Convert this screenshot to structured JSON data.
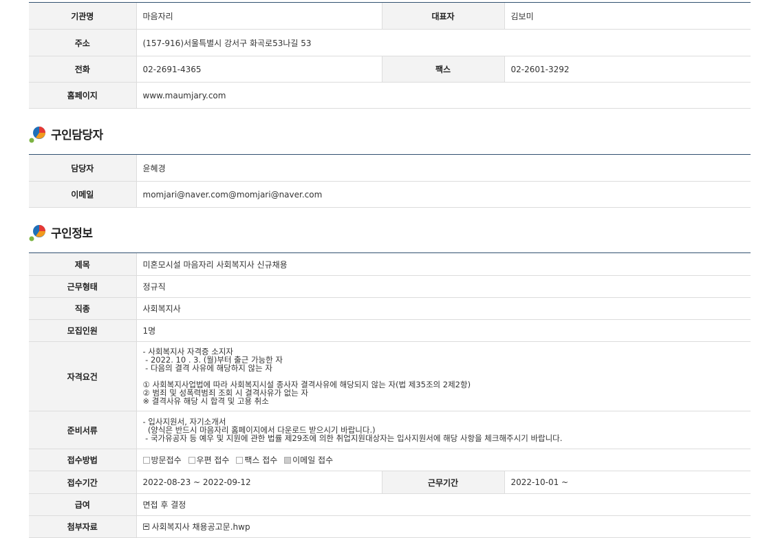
{
  "org": {
    "name_label": "기관명",
    "name": "마음자리",
    "ceo_label": "대표자",
    "ceo": "김보미",
    "address_label": "주소",
    "address": "(157-916)서울특별시 강서구 화곡로53나길 53",
    "phone_label": "전화",
    "phone": "02-2691-4365",
    "fax_label": "팩스",
    "fax": "02-2601-3292",
    "homepage_label": "홈페이지",
    "homepage": "www.maumjary.com"
  },
  "contact": {
    "title": "구인담당자",
    "manager_label": "담당자",
    "manager": "윤혜경",
    "email_label": "이메일",
    "email": "momjari@naver.com@momjari@naver.com"
  },
  "job": {
    "title": "구인정보",
    "subject_label": "제목",
    "subject": "미혼모시설 마음자리 사회복지사 신규채용",
    "worktype_label": "근무형태",
    "worktype": "정규직",
    "occupation_label": "직종",
    "occupation": "사회복지사",
    "headcount_label": "모집인원",
    "headcount": "1명",
    "requirements_label": "자격요건",
    "requirements": "- 사회복지사 자격증 소지자\n - 2022. 10 . 3. (월)부터 출근 가능한 자\n - 다음의 결격 사유에 해당하지 않는 자\n\n① 사회복지사업법에 따라 사회복지시설 종사자 결격사유에 해당되지 않는 자(법 제35조의 2제2항)\n② 범죄 및 성폭력범죄 조회 시 결격사유가 없는 자\n※ 결격사유 해당 시 합격 및 고용 취소",
    "documents_label": "준비서류",
    "documents": "- 입사지원서, 자기소개서\n  (양식은 반드시 마음자리 홈페이지에서 다운로드 받으시기 바랍니다.)\n - 국가유공자 등 예우 및 지원에 관한 법률 제29조에 의한 취업지원대상자는 입사지원서에 해당 사항을 체크해주시기 바랍니다.",
    "method_label": "접수방법",
    "methods": [
      {
        "label": "방문접수",
        "checked": false
      },
      {
        "label": "우편 접수",
        "checked": false
      },
      {
        "label": "팩스 접수",
        "checked": false
      },
      {
        "label": "이메일 접수",
        "checked": true
      }
    ],
    "period_label": "접수기간",
    "period": "2022-08-23 ~ 2022-09-12",
    "workperiod_label": "근무기간",
    "workperiod": "2022-10-01 ~",
    "salary_label": "급여",
    "salary": "면접 후 결정",
    "attachment_label": "첨부자료",
    "attachment": "사회복지사 채용공고문.hwp"
  },
  "colors": {
    "header_line": "#2f4f6f",
    "th_bg": "#f3f3f3",
    "icon_blue": "#1f6fb8",
    "icon_orange": "#f29a1d",
    "icon_green": "#7cb342"
  }
}
